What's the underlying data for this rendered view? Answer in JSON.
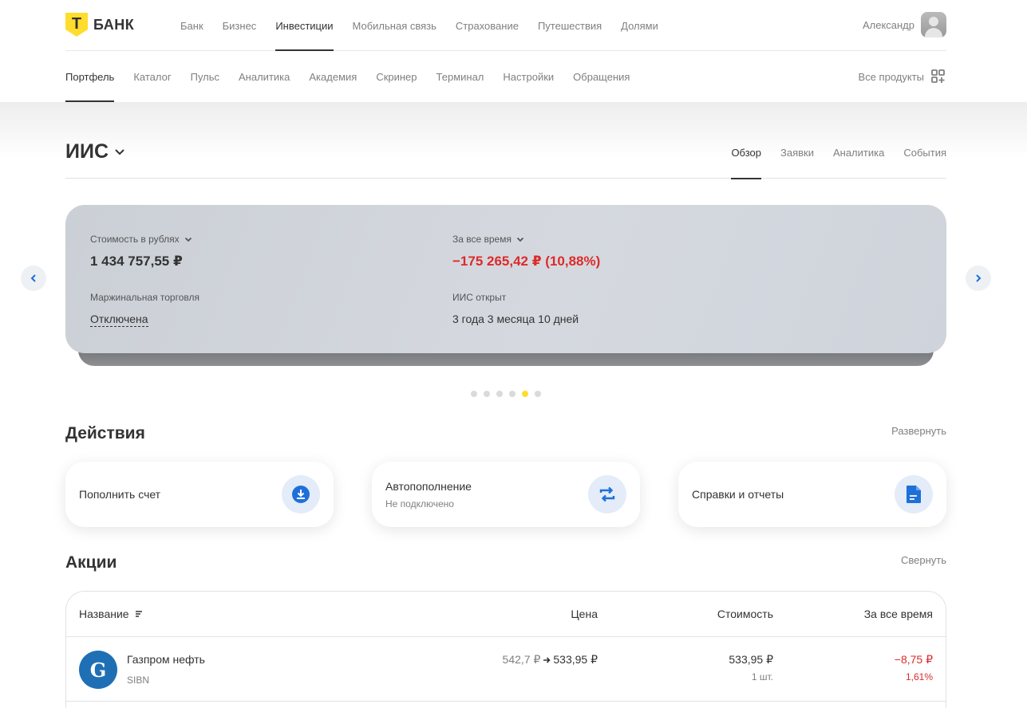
{
  "brand": {
    "logo_letter": "Т",
    "name": "БАНК"
  },
  "topnav": {
    "items": [
      {
        "label": "Банк"
      },
      {
        "label": "Бизнес"
      },
      {
        "label": "Инвестиции",
        "active": true
      },
      {
        "label": "Мобильная связь"
      },
      {
        "label": "Страхование"
      },
      {
        "label": "Путешествия"
      },
      {
        "label": "Долями"
      }
    ],
    "user_name": "Александр"
  },
  "subnav": {
    "items": [
      {
        "label": "Портфель",
        "active": true
      },
      {
        "label": "Каталог"
      },
      {
        "label": "Пульс"
      },
      {
        "label": "Аналитика"
      },
      {
        "label": "Академия"
      },
      {
        "label": "Скринер"
      },
      {
        "label": "Терминал"
      },
      {
        "label": "Настройки"
      },
      {
        "label": "Обращения"
      }
    ],
    "all_products": "Все продукты"
  },
  "account": {
    "title": "ИИС",
    "tabs": [
      {
        "label": "Обзор",
        "active": true
      },
      {
        "label": "Заявки"
      },
      {
        "label": "Аналитика"
      },
      {
        "label": "События"
      }
    ]
  },
  "summary": {
    "value_label": "Стоимость в рублях",
    "value": "1 434 757,55 ₽",
    "alltime_label": "За все время",
    "alltime_value": "−175 265,42 ₽ (10,88%)",
    "margin_label": "Маржинальная торговля",
    "margin_value": "Отключена",
    "opened_label": "ИИС открыт",
    "opened_value": "3 года 3 месяца 10 дней",
    "carousel_count": 6,
    "carousel_active": 5
  },
  "actions": {
    "title": "Действия",
    "expand": "Развернуть",
    "items": [
      {
        "title": "Пополнить счет",
        "icon": "download-icon"
      },
      {
        "title": "Автопополнение",
        "subtitle": "Не подключено",
        "icon": "repeat-icon"
      },
      {
        "title": "Справки и отчеты",
        "icon": "document-icon"
      }
    ]
  },
  "stocks": {
    "title": "Акции",
    "collapse": "Свернуть",
    "columns": [
      "Название",
      "Цена",
      "Стоимость",
      "За все время"
    ],
    "rows": [
      {
        "name": "Газпром нефть",
        "ticker": "SIBN",
        "price_from": "542,7 ₽",
        "price_to": "533,95 ₽",
        "value": "533,95 ₽",
        "qty": "1 шт.",
        "change": "−8,75 ₽",
        "change_pct": "1,61%"
      }
    ]
  },
  "colors": {
    "accent": "#ffdd2d",
    "negative": "#dd2a2a",
    "action_blue": "#1f6fd8"
  }
}
